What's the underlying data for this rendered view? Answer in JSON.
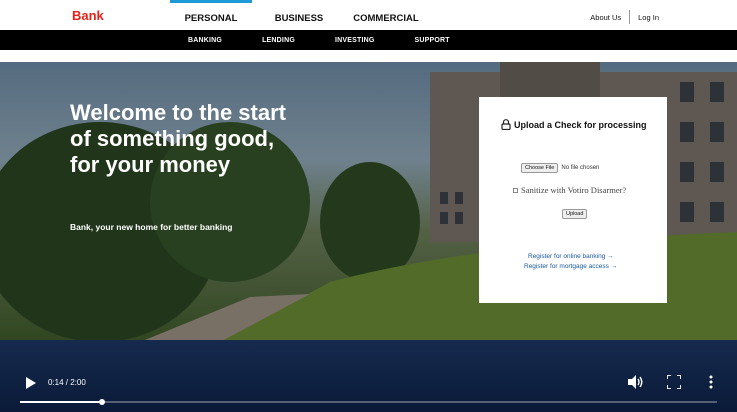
{
  "header": {
    "brand": "Bank",
    "primary_tabs": [
      {
        "label": "PERSONAL",
        "active": true
      },
      {
        "label": "BUSINESS",
        "active": false
      },
      {
        "label": "COMMERCIAL",
        "active": false
      }
    ],
    "about_label": "About Us",
    "login_label": "Log In"
  },
  "subnav": {
    "items": [
      "BANKING",
      "LENDING",
      "INVESTING",
      "SUPPORT"
    ]
  },
  "hero": {
    "title": "Welcome to the start of something good, for your money",
    "subtitle": "Bank, your new home for better banking"
  },
  "upload_card": {
    "title": "Upload a Check for processing",
    "choose_file_label": "Choose File",
    "file_status": "No file chosen",
    "sanitize_label": "Sanitize with Votiro Disarmer?",
    "sanitize_checked": false,
    "upload_label": "Upload",
    "link_online": "Register for online banking →",
    "link_mortgage": "Register for mortgage access →"
  },
  "video": {
    "current_time": "0:14",
    "separator": " / ",
    "duration": "2:00",
    "progress": 0.117
  },
  "colors": {
    "brand": "#e8221b",
    "accent": "#1e9bd7",
    "link": "#1a5aa0",
    "video_bg": "#0a1a38"
  },
  "icons": [
    "lock-icon",
    "play-icon",
    "volume-icon",
    "fullscreen-icon",
    "more-vert-icon"
  ]
}
